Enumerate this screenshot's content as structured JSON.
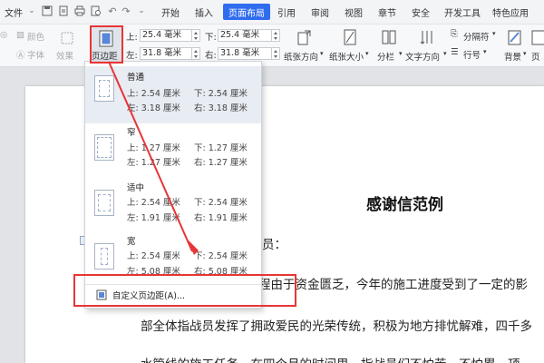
{
  "menubar": {
    "file_label": "文件",
    "tabs": [
      {
        "label": "开始"
      },
      {
        "label": "插入"
      },
      {
        "label": "页面布局"
      },
      {
        "label": "引用"
      },
      {
        "label": "审阅"
      },
      {
        "label": "视图"
      },
      {
        "label": "章节"
      },
      {
        "label": "安全"
      },
      {
        "label": "开发工具"
      },
      {
        "label": "特色应用"
      }
    ],
    "active_tab": "页面布局"
  },
  "ribbon": {
    "color_label": "颜色",
    "font_label": "字体",
    "effect_label": "效果",
    "margins_button": "页边距",
    "margin_top": {
      "label": "上:",
      "value": "25.4 毫米"
    },
    "margin_bottom": {
      "label": "下:",
      "value": "25.4 毫米"
    },
    "margin_left": {
      "label": "左:",
      "value": "31.8 毫米"
    },
    "margin_right": {
      "label": "右:",
      "value": "31.8 毫米"
    },
    "orientation": "纸张方向",
    "size": "纸张大小",
    "columns": "分栏",
    "text_direction": "文字方向",
    "breaks": "分隔符",
    "line_numbers": "行号",
    "background": "背景",
    "borders": "页"
  },
  "dropdown": {
    "presets": [
      {
        "name": "普通",
        "top": "上: 2.54 厘米",
        "bottom": "下: 2.54 厘米",
        "left": "左: 3.18 厘米",
        "right": "右: 3.18 厘米"
      },
      {
        "name": "窄",
        "top": "上: 1.27 厘米",
        "bottom": "下: 1.27 厘米",
        "left": "左: 1.27 厘米",
        "right": "右: 1.27 厘米"
      },
      {
        "name": "适中",
        "top": "上: 2.54 厘米",
        "bottom": "下: 2.54 厘米",
        "left": "左: 1.91 厘米",
        "right": "右: 1.91 厘米"
      },
      {
        "name": "宽",
        "top": "上: 2.54 厘米",
        "bottom": "下: 2.54 厘米",
        "left": "左: 5.08 厘米",
        "right": "右: 5.08 厘米"
      }
    ],
    "custom_label": "自定义页边距(A)..."
  },
  "document": {
    "title": "感谢信范例",
    "line1": "员：",
    "line2": "程由于资金匮乏，今年的施工进度受到了一定的影",
    "line3": "部全体指战员发挥了拥政爱民的光荣传统，积极为地方排忧解难，四千多",
    "line4": "水管线的施工任务，在四个月的时间里，指战员们不怕苦、不怕累，顶"
  },
  "colors": {
    "accent": "#2f6cf0",
    "annotation": "#e83535"
  }
}
